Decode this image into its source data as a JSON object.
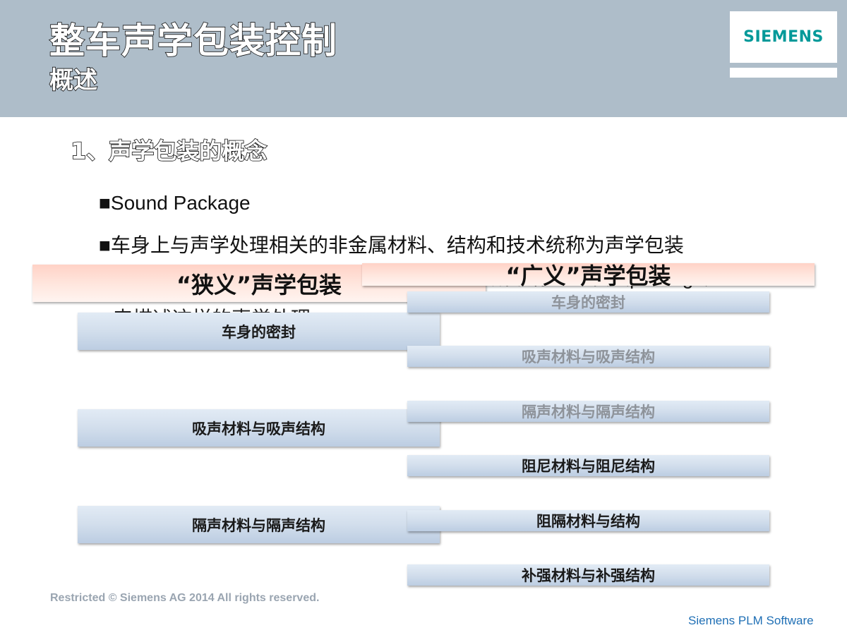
{
  "header": {
    "title": "整车声学包装控制",
    "subtitle": "概述",
    "logo_text": "SIEMENS"
  },
  "section_heading": "1、声学包装的概念",
  "bullets": [
    "■Sound Package",
    "■车身上与声学处理相关的非金属材料、结构和技术统称为声学包装",
    "所以称之包装（package）",
    "来描述这样的声学处理"
  ],
  "narrow": {
    "label": "“狭义”声学包装",
    "items": [
      "车身的密封",
      "吸声材料与吸声结构",
      "隔声材料与隔声结构"
    ]
  },
  "broad": {
    "label": "“广义”声学包装",
    "items": [
      "车身的密封",
      "吸声材料与吸声结构",
      "隔声材料与隔声结构",
      "阻尼材料与阻尼结构",
      "阻隔材料与结构",
      "补强材料与补强结构"
    ]
  },
  "footer": {
    "copyright": "Restricted © Siemens AG 2014 All rights reserved.",
    "brand": "Siemens PLM Software"
  }
}
